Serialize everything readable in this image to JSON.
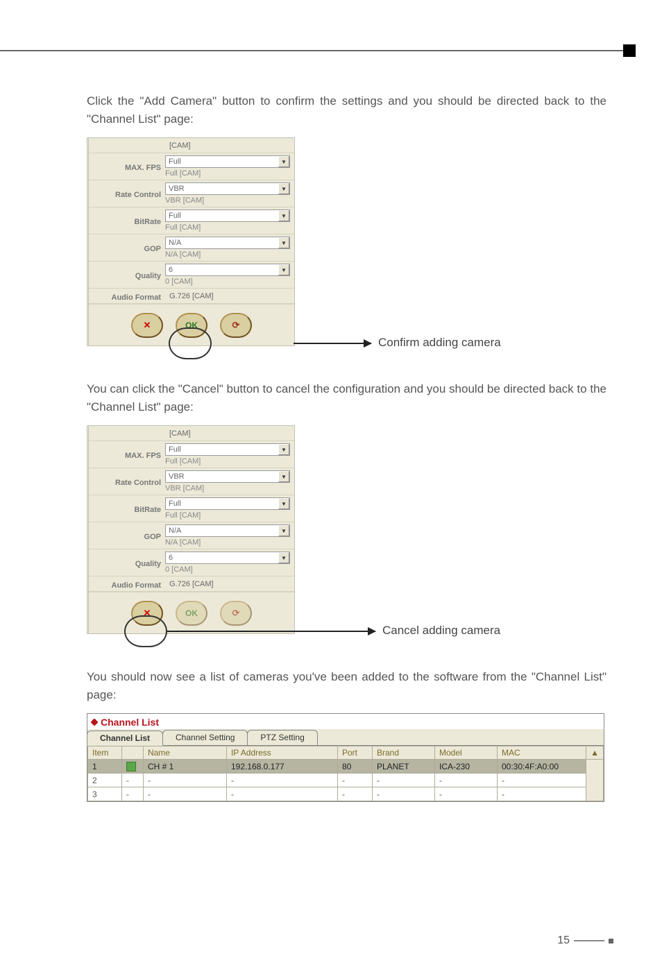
{
  "para1": "Click the \"Add Camera\" button to confirm the settings and you should be directed back to the \"Channel List\" page:",
  "para2": "You can click the \"Cancel\" button to cancel the configuration and you should be directed back to the \"Channel List\" page:",
  "para3": "You should now see a list of cameras you've been added to the software from the \"Channel List\" page:",
  "panel": {
    "header_cam": "[CAM]",
    "maxfps_label": "MAX. FPS",
    "maxfps_value": "Full",
    "maxfps_sub": "Full [CAM]",
    "rate_label": "Rate Control",
    "rate_value": "VBR",
    "rate_sub": "VBR [CAM]",
    "bitrate_label": "BitRate",
    "bitrate_value": "Full",
    "bitrate_sub": "Full [CAM]",
    "gop_label": "GOP",
    "gop_value": "N/A",
    "gop_sub": "N/A [CAM]",
    "quality_label": "Quality",
    "quality_value": "6",
    "quality_sub": "0 [CAM]",
    "audio_label": "Audio Format",
    "audio_value": "G.726 [CAM]"
  },
  "buttons": {
    "cancel_glyph": "✕",
    "ok_glyph": "OK",
    "refresh_glyph": "⟳"
  },
  "callout_confirm": "Confirm adding camera",
  "callout_cancel": "Cancel adding camera",
  "chlist": {
    "title": "Channel List",
    "tabs": {
      "list": "Channel List",
      "setting": "Channel Setting",
      "ptz": "PTZ Setting"
    },
    "cols": {
      "item": "Item",
      "name": "Name",
      "ip": "IP Address",
      "port": "Port",
      "brand": "Brand",
      "model": "Model",
      "mac": "MAC"
    },
    "rows": [
      {
        "item": "1",
        "name": "CH # 1",
        "ip": "192.168.0.177",
        "port": "80",
        "brand": "PLANET",
        "model": "ICA-230",
        "mac": "00:30:4F:A0:00"
      },
      {
        "item": "2",
        "name": "-",
        "ip": "-",
        "port": "-",
        "brand": "-",
        "model": "-",
        "mac": "-"
      },
      {
        "item": "3",
        "name": "-",
        "ip": "-",
        "port": "-",
        "brand": "-",
        "model": "-",
        "mac": "-"
      }
    ]
  },
  "pagenum": "15"
}
